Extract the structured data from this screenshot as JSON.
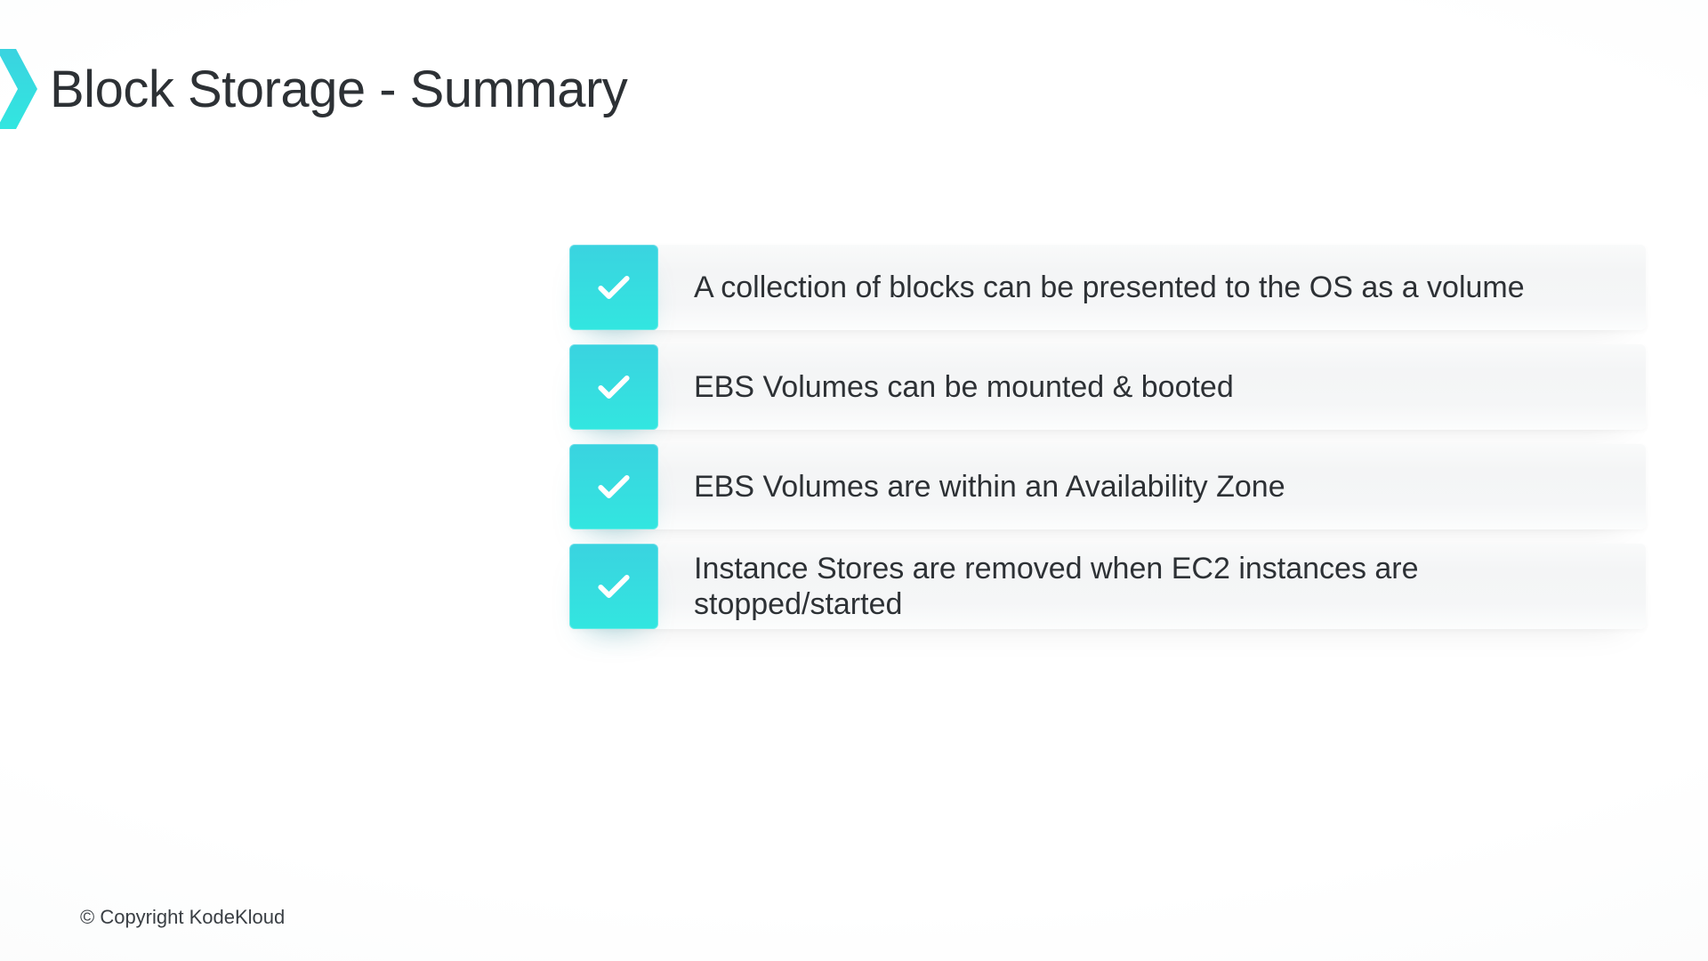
{
  "title": "Block Storage - Summary",
  "accent_color": "#33dfe0",
  "items": [
    {
      "text": "A collection of blocks can be presented to the OS as a volume"
    },
    {
      "text": "EBS Volumes can be mounted & booted"
    },
    {
      "text": "EBS Volumes are within an Availability Zone"
    },
    {
      "text": "Instance Stores are removed when EC2 instances are stopped/started"
    }
  ],
  "copyright": "© Copyright KodeKloud"
}
